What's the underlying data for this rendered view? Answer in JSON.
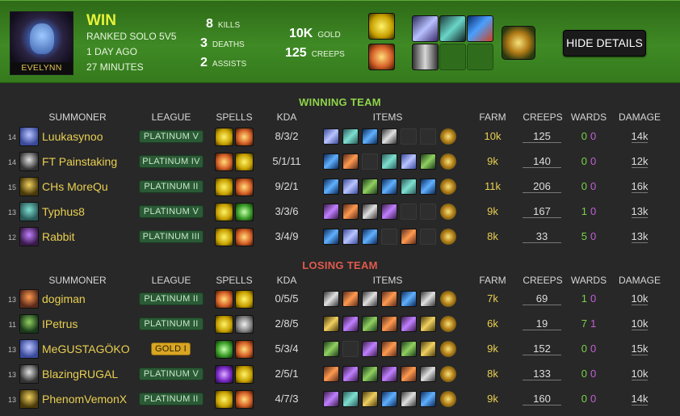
{
  "header": {
    "champion": "EVELYNN",
    "result": "WIN",
    "queue": "RANKED SOLO 5V5",
    "when": "1 DAY AGO",
    "duration": "27 MINUTES",
    "kills": "8",
    "kills_label": "KILLS",
    "deaths": "3",
    "deaths_label": "DEATHS",
    "assists": "2",
    "assists_label": "ASSISTS",
    "gold": "10k",
    "gold_label": "GOLD",
    "creeps": "125",
    "creeps_label": "CREEPS",
    "hide_details": "HIDE DETAILS",
    "colors": {
      "win": "#e6f23a",
      "header_bg": "#3f8a25"
    }
  },
  "columns": {
    "summoner": "SUMMONER",
    "league": "LEAGUE",
    "spells": "SPELLS",
    "kda": "KDA",
    "items": "ITEMS",
    "farm": "FARM",
    "creeps": "CREEPS",
    "wards": "WARDS",
    "damage": "DAMAGE"
  },
  "winning": {
    "title": "WINNING TEAM",
    "rows": [
      {
        "level": "14",
        "name": "Luukasynoo",
        "league": "PLATINUM V",
        "kda": "8/3/2",
        "farm": "10k",
        "creeps": "125",
        "w1": "0",
        "w2": "0",
        "damage": "14k"
      },
      {
        "level": "14",
        "name": "FT Painstaking",
        "league": "PLATINUM IV",
        "kda": "5/1/11",
        "farm": "9k",
        "creeps": "140",
        "w1": "0",
        "w2": "0",
        "damage": "12k"
      },
      {
        "level": "15",
        "name": "CHs MoreQu",
        "league": "PLATINUM II",
        "kda": "9/2/1",
        "farm": "11k",
        "creeps": "206",
        "w1": "0",
        "w2": "0",
        "damage": "16k"
      },
      {
        "level": "13",
        "name": "Typhus8",
        "league": "PLATINUM V",
        "kda": "3/3/6",
        "farm": "9k",
        "creeps": "167",
        "w1": "1",
        "w2": "0",
        "damage": "13k"
      },
      {
        "level": "12",
        "name": "Rabbit",
        "league": "PLATINUM III",
        "kda": "3/4/9",
        "farm": "8k",
        "creeps": "33",
        "w1": "5",
        "w2": "0",
        "damage": "13k"
      }
    ]
  },
  "losing": {
    "title": "LOSING TEAM",
    "rows": [
      {
        "level": "13",
        "name": "dogiman",
        "league": "PLATINUM II",
        "kda": "0/5/5",
        "farm": "7k",
        "creeps": "69",
        "w1": "1",
        "w2": "0",
        "damage": "10k"
      },
      {
        "level": "11",
        "name": "IPetrus",
        "league": "PLATINUM II",
        "kda": "2/8/5",
        "farm": "6k",
        "creeps": "19",
        "w1": "7",
        "w2": "1",
        "damage": "10k"
      },
      {
        "level": "13",
        "name": "MeGUSTAGÖKO",
        "league": "GOLD I",
        "kda": "5/3/4",
        "farm": "9k",
        "creeps": "152",
        "w1": "0",
        "w2": "0",
        "damage": "15k"
      },
      {
        "level": "13",
        "name": "BlazingRUGAL",
        "league": "PLATINUM V",
        "kda": "2/5/1",
        "farm": "8k",
        "creeps": "133",
        "w1": "0",
        "w2": "0",
        "damage": "10k"
      },
      {
        "level": "13",
        "name": "PhenomVemonX",
        "league": "PLATINUM II",
        "kda": "4/7/3",
        "farm": "9k",
        "creeps": "160",
        "w1": "0",
        "w2": "0",
        "damage": "14k"
      }
    ]
  }
}
